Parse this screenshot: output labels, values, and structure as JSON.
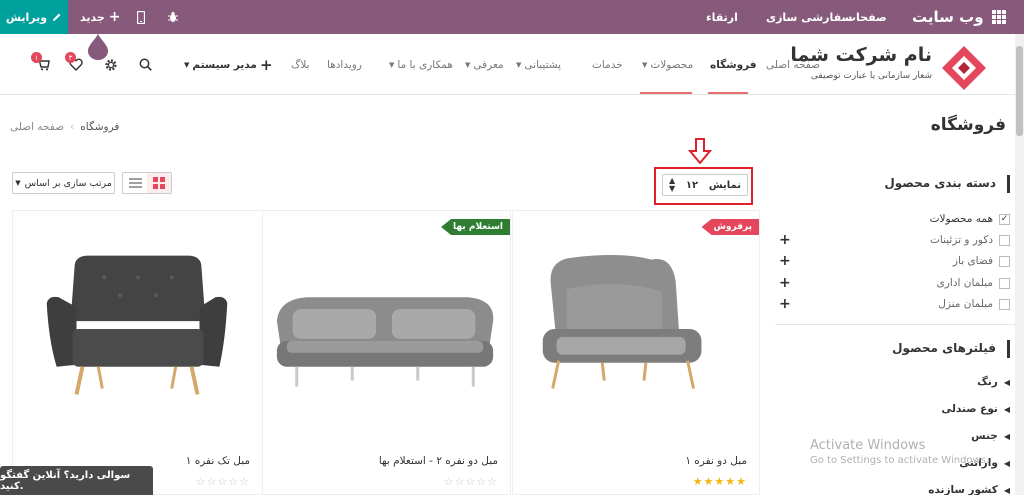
{
  "admin_bar": {
    "edit_label": "ویرایش",
    "new_label": "جدید",
    "brand": "وب سایت",
    "pages": "صفحات",
    "customize": "سفارشی سازی",
    "upgrade": "ارتقاء"
  },
  "logo": {
    "name": "نام شرکت شما",
    "tagline": "شعار سازمانی یا عبارت توصیفی"
  },
  "nav": {
    "home": "صفحه اصلی",
    "shop": "فروشگاه",
    "products": "محصولات",
    "services": "خدمات",
    "support": "پشتیبانی",
    "intro": "معرفی",
    "cooperate": "همکاری با ما",
    "events": "رویدادها",
    "blog": "بلاگ",
    "user": "مدیر سیستم",
    "cart_count": "۱",
    "wishlist_count": "۳"
  },
  "breadcrumb": {
    "home": "صفحه اصلی",
    "current": "فروشگاه"
  },
  "page_title": "فروشگاه",
  "toolbar": {
    "sort_label": "مرتب سازی بر اساس",
    "ppg_label": "نمایش",
    "ppg_value": "۱۲"
  },
  "sidebar": {
    "categories_title": "دسته بندی محصول",
    "categories": [
      {
        "label": "همه محصولات",
        "checked": true,
        "expandable": false
      },
      {
        "label": "دکور و تزئینات",
        "checked": false,
        "expandable": true
      },
      {
        "label": "فضای باز",
        "checked": false,
        "expandable": true
      },
      {
        "label": "مبلمان اداری",
        "checked": false,
        "expandable": true
      },
      {
        "label": "مبلمان منزل",
        "checked": false,
        "expandable": true
      }
    ],
    "filters_title": "فیلترهای محصول",
    "filters": [
      "رنگ",
      "نوع صندلی",
      "جنس",
      "وارانتی",
      "کشور سازنده"
    ]
  },
  "products": [
    {
      "name": "مبل دو نفره ۱",
      "ribbon": "پرفروش",
      "ribbon_color": "#e4475b",
      "rating": 5
    },
    {
      "name": "مبل دو نفره ۲ - استعلام بها",
      "ribbon": "استعلام بها",
      "ribbon_color": "#2e7d32",
      "rating": 0
    },
    {
      "name": "مبل تک نفره ۱",
      "ribbon": "",
      "ribbon_color": "",
      "rating": 0
    }
  ],
  "chat_label": "سوالی دارید؟ آنلاین گفتگو کنید.",
  "watermark": {
    "line1": "Activate Windows",
    "line2": "Go to Settings to activate Windows."
  },
  "colors": {
    "admin_bar": "#875a7b",
    "edit": "#00a09d",
    "accent": "#e4475b",
    "star": "#f3b713"
  }
}
